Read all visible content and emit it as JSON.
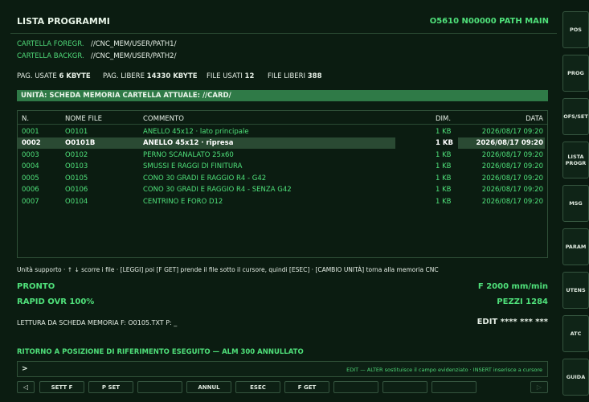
{
  "header": {
    "title": "LISTA PROGRAMMI",
    "right": "O5610 N00000 PATH MAIN"
  },
  "folders": {
    "fore_label": "CARTELLA FOREGR.",
    "fore_value": "//CNC_MEM/USER/PATH1/",
    "back_label": "CARTELLA BACKGR.",
    "back_value": "//CNC_MEM/USER/PATH2/"
  },
  "stats": {
    "used_pages_label": "PAG. USATE",
    "used_pages_value": "6 KBYTE",
    "free_pages_label": "PAG. LIBERE",
    "free_pages_value": "14330 KBYTE",
    "used_files_label": "FILE USATI",
    "used_files_value": "12",
    "free_files_label": "FILE LIBERI",
    "free_files_value": "388"
  },
  "unit_bar": "UNITÀ: SCHEDA MEMORIA CARTELLA ATTUALE: //CARD/",
  "table": {
    "columns": [
      "N.",
      "NOME FILE",
      "COMMENTO",
      "DIM.",
      "DATA"
    ],
    "rows": [
      {
        "n": "0001",
        "name": "O0101",
        "comment": "ANELLO 45x12 · lato principale",
        "size": "1 KB",
        "date": "2026/08/17 09:20"
      },
      {
        "n": "0002",
        "name": "O0101B",
        "comment": "ANELLO 45x12 · ripresa",
        "size": "1 KB",
        "date": "2026/08/17 09:20"
      },
      {
        "n": "0003",
        "name": "O0102",
        "comment": "PERNO SCANALATO 25x60",
        "size": "1 KB",
        "date": "2026/08/17 09:20"
      },
      {
        "n": "0004",
        "name": "O0103",
        "comment": "SMUSSI E RAGGI DI FINITURA",
        "size": "1 KB",
        "date": "2026/08/17 09:20"
      },
      {
        "n": "0005",
        "name": "O0105",
        "comment": "CONO 30 GRADI E RAGGIO R4 - G42",
        "size": "1 KB",
        "date": "2026/08/17 09:20"
      },
      {
        "n": "0006",
        "name": "O0106",
        "comment": "CONO 30 GRADI E RAGGIO R4 - SENZA G42",
        "size": "1 KB",
        "date": "2026/08/17 09:20"
      },
      {
        "n": "0007",
        "name": "O0104",
        "comment": "CENTRINO E FORO D12",
        "size": "1 KB",
        "date": "2026/08/17 09:20"
      }
    ]
  },
  "hint": "Unità supporto · ↑ ↓ scorre i file · [LEGGI] poi [F GET] prende il file sotto il cursore, quindi [ESEC] · [CAMBIO UNITÀ] torna alla memoria CNC",
  "status": {
    "state": "PRONTO",
    "feed": "F 2000 mm/min",
    "rapid": "RAPID OVR 100%",
    "pieces": "PEZZI 1284",
    "reading": "LETTURA DA SCHEDA MEMORIA F: O0105.TXT P: _",
    "mode": "EDIT **** *** ***",
    "alarm": "RITORNO A POSIZIONE DI RIFERIMENTO ESEGUITO — ALM 300 ANNULLATO"
  },
  "command": {
    "prompt": ">",
    "help": "EDIT — ALTER sostituisce il campo evidenziato · INSERT inserisce a cursore"
  },
  "fkeys": [
    "SETT F",
    "P SET",
    "",
    "ANNUL",
    "ESEC",
    "F GET",
    "",
    "",
    ""
  ],
  "arrows": {
    "left": "◁",
    "right": "▷"
  },
  "softkeys": [
    "POS",
    "PROG",
    "OFS/SET",
    "LISTA PROGR",
    "MSG",
    "PARAM",
    "UTENS",
    "ATC",
    "GUIDA"
  ]
}
